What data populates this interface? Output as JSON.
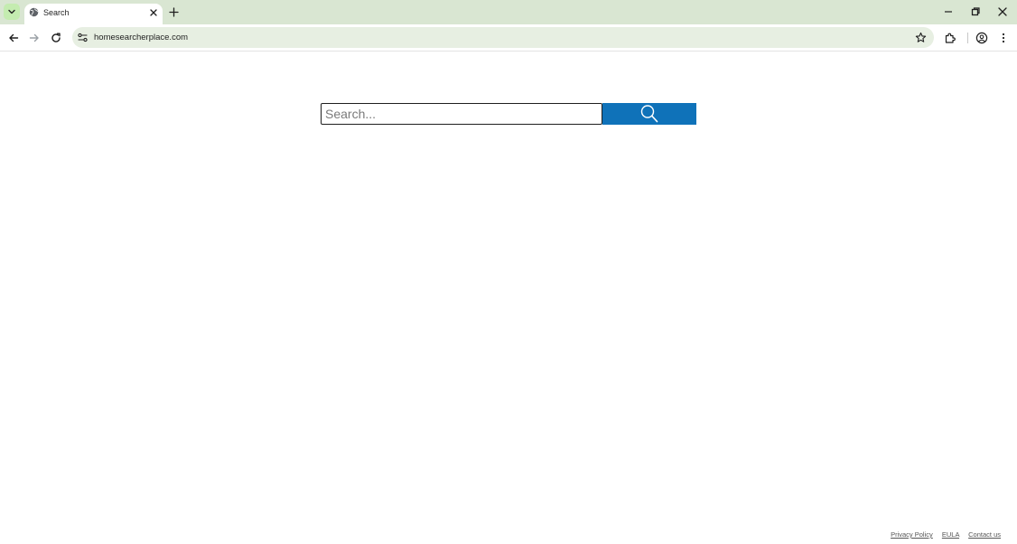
{
  "browser": {
    "tab": {
      "title": "Search",
      "favicon": "globe-icon"
    },
    "address_bar": {
      "url": "homesearcherplace.com"
    }
  },
  "search": {
    "placeholder": "Search...",
    "value": "",
    "button_icon": "magnifier-icon",
    "button_color": "#0f72b9"
  },
  "footer": {
    "links": [
      "Privacy Policy",
      "EULA",
      "Contact us"
    ]
  }
}
